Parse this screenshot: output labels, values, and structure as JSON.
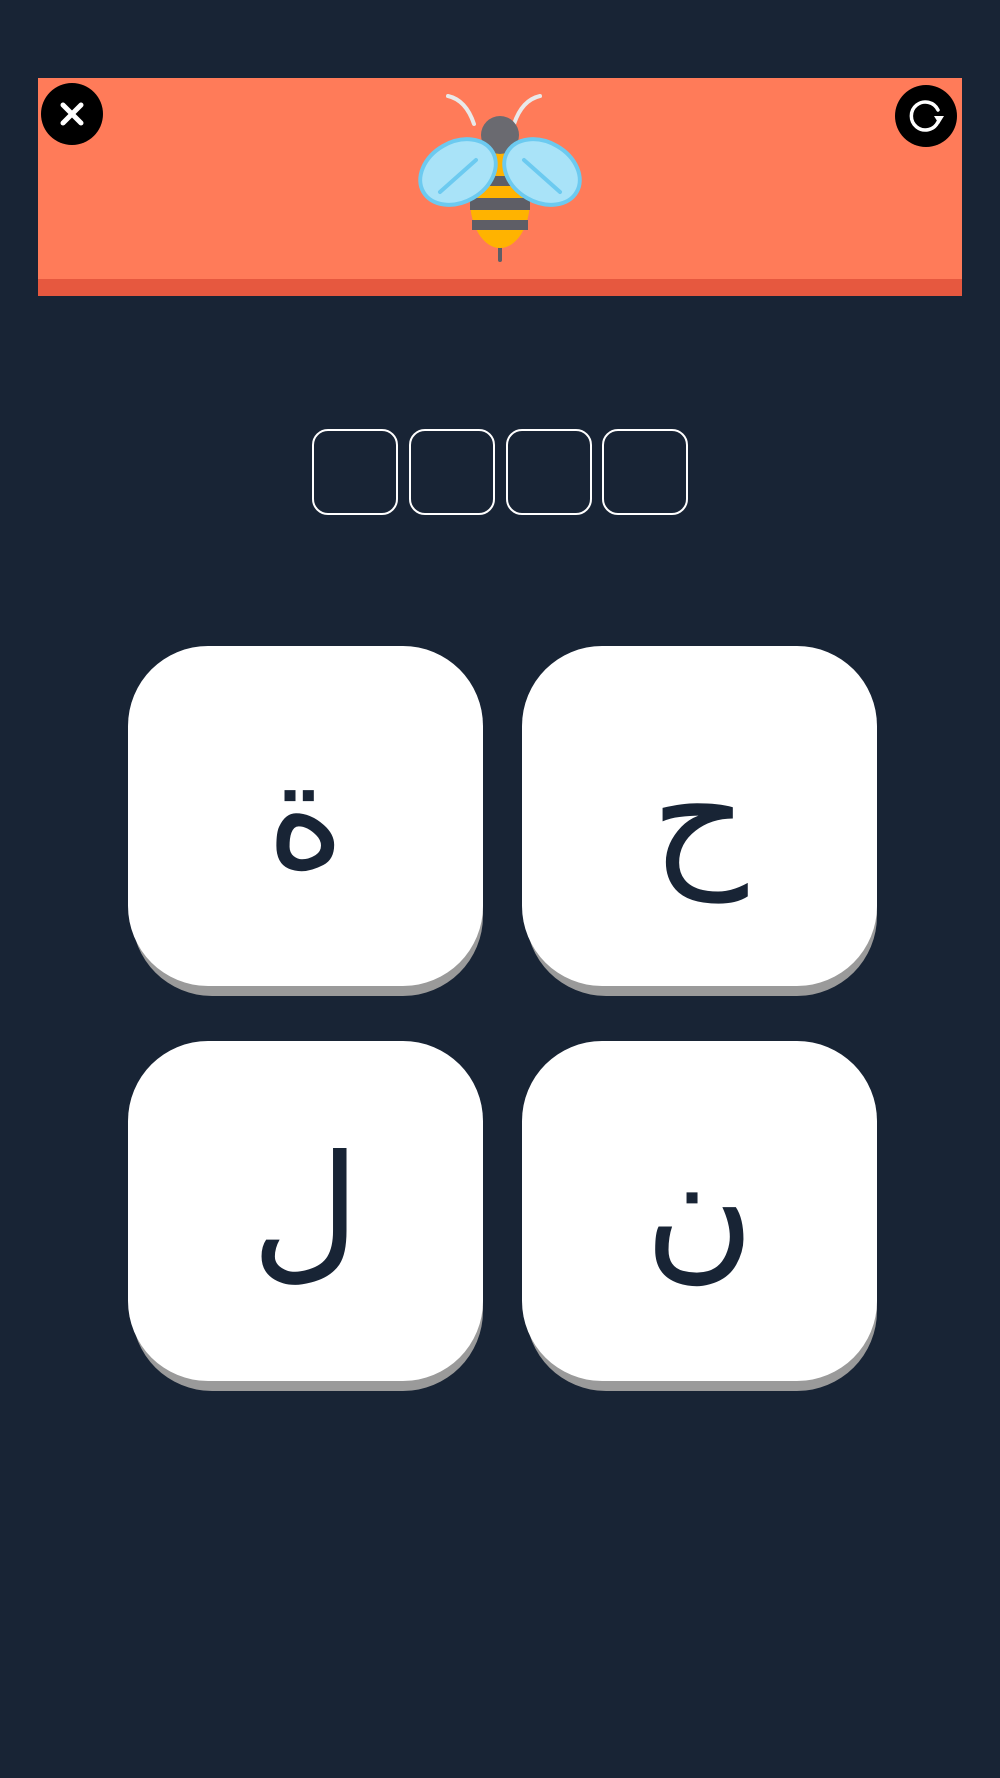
{
  "header": {
    "picture": "bee",
    "close_icon": "close-icon",
    "restart_icon": "restart-icon",
    "colors": {
      "banner": "#ff7b59",
      "banner_strip": "#e6583f",
      "background": "#182435"
    }
  },
  "answer": {
    "slot_count": 4,
    "slots": [
      "",
      "",
      "",
      ""
    ]
  },
  "tiles": [
    {
      "letter": "ة"
    },
    {
      "letter": "ح"
    },
    {
      "letter": "ل"
    },
    {
      "letter": "ن"
    }
  ]
}
